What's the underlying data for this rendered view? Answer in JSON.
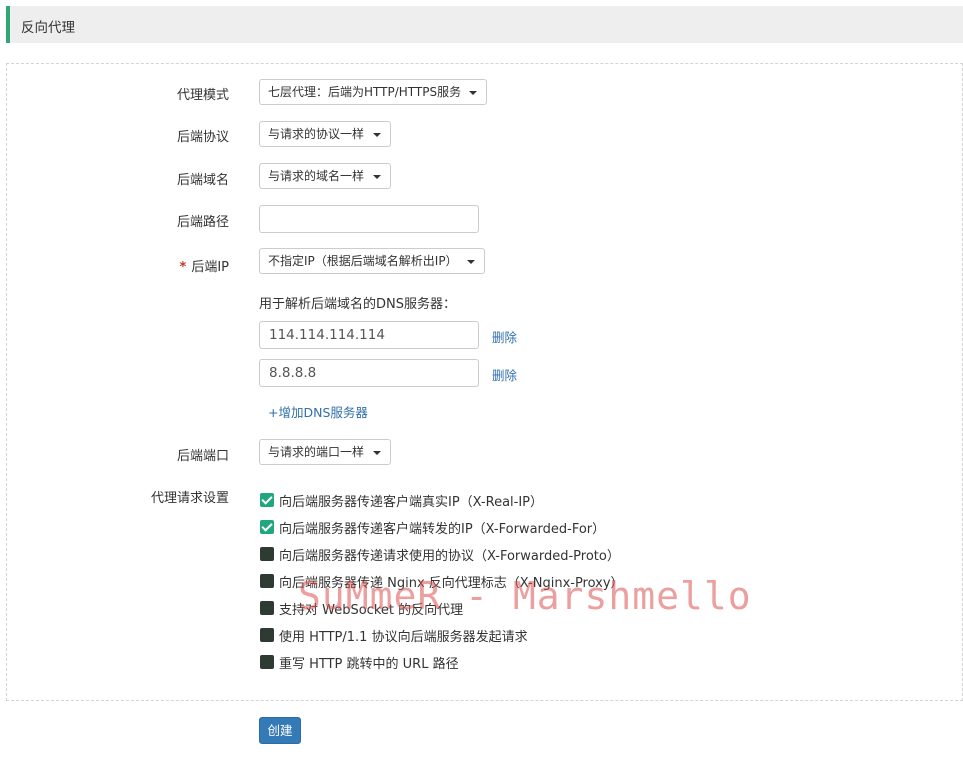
{
  "header": {
    "title": "反向代理"
  },
  "form": {
    "proxy_mode": {
      "label": "代理模式",
      "value": "七层代理：后端为HTTP/HTTPS服务"
    },
    "backend_protocol": {
      "label": "后端协议",
      "value": "与请求的协议一样"
    },
    "backend_domain": {
      "label": "后端域名",
      "value": "与请求的域名一样"
    },
    "backend_path": {
      "label": "后端路径",
      "value": "",
      "placeholder": ""
    },
    "backend_ip": {
      "required_mark": "*",
      "label": "后端IP",
      "value": "不指定IP（根据后端域名解析出IP）"
    },
    "dns": {
      "hint": "用于解析后端域名的DNS服务器：",
      "servers": [
        {
          "value": "114.114.114.114",
          "delete_label": "删除"
        },
        {
          "value": "8.8.8.8",
          "delete_label": "删除"
        }
      ],
      "add_label": "+增加DNS服务器"
    },
    "backend_port": {
      "label": "后端端口",
      "value": "与请求的端口一样"
    },
    "proxy_settings": {
      "label": "代理请求设置",
      "options": [
        {
          "label": "向后端服务器传递客户端真实IP（X-Real-IP）",
          "checked": true
        },
        {
          "label": "向后端服务器传递客户端转发的IP（X-Forwarded-For）",
          "checked": true
        },
        {
          "label": "向后端服务器传递请求使用的协议（X-Forwarded-Proto）",
          "checked": false
        },
        {
          "label": "向后端服务器传递 Nginx 反向代理标志（X-Nginx-Proxy）",
          "checked": false
        },
        {
          "label": "支持对 WebSocket 的反向代理",
          "checked": false
        },
        {
          "label": "使用 HTTP/1.1 协议向后端服务器发起请求",
          "checked": false
        },
        {
          "label": "重写 HTTP 跳转中的 URL 路径",
          "checked": false
        }
      ]
    },
    "submit_label": "创建"
  },
  "watermark": "SuMmeR - Marshmello",
  "colors": {
    "accent": "#2ea772",
    "checkbox_checked": "#21a682",
    "link": "#2f6fab",
    "button": "#337ab7"
  }
}
